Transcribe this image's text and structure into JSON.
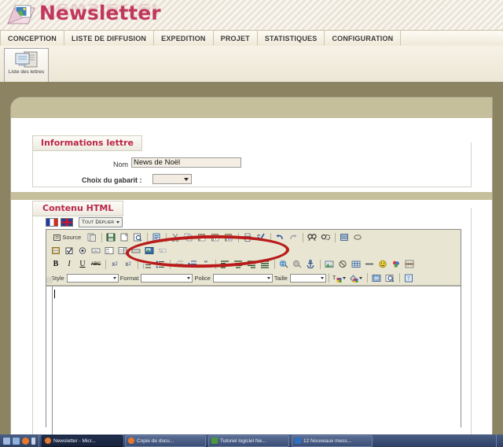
{
  "app": {
    "title": "Newsletter",
    "logo_icon": "envelope-letter-icon"
  },
  "main_menu": {
    "items": [
      {
        "label": "CONCEPTION",
        "name": "menu-conception"
      },
      {
        "label": "LISTE DE DIFFUSION",
        "name": "menu-liste-de-diffusion"
      },
      {
        "label": "EXPEDITION",
        "name": "menu-expedition"
      },
      {
        "label": "PROJET",
        "name": "menu-projet"
      },
      {
        "label": "STATISTIQUES",
        "name": "menu-statistiques"
      },
      {
        "label": "CONFIGURATION",
        "name": "menu-configuration"
      }
    ]
  },
  "toolbar": {
    "liste_des_lettres_label": "Liste des lettres",
    "liste_des_lettres_icon": "screen-document-icon"
  },
  "infos_lettre": {
    "legend": "Informations lettre",
    "nom_label": "Nom",
    "nom_value": "News de Noël",
    "gabarit_label": "Choix du gabarit :",
    "gabarit_value": ""
  },
  "annotation": {
    "shape": "red-ellipse-highlight",
    "color": "#b91b1b",
    "targets": "nom-input"
  },
  "contenu_html": {
    "legend": "Contenu HTML",
    "lang_flags": [
      {
        "name": "flag-fr-icon",
        "label": "Français"
      },
      {
        "name": "flag-uk-icon",
        "label": "English"
      }
    ],
    "tout_deplier_label": "Tout Déplier"
  },
  "editor": {
    "name": "html-wysiwyg-editor",
    "source_label": "Source",
    "rows": [
      {
        "name": "editor-toolbar-row-1",
        "items": [
          {
            "name": "source-button",
            "glyph": "☰",
            "label": "Source",
            "wide": true
          },
          {
            "name": "templates-icon",
            "glyph": "❐"
          },
          {
            "sep": true
          },
          {
            "name": "save-icon",
            "glyph": "▣"
          },
          {
            "name": "new-page-icon",
            "glyph": "☐"
          },
          {
            "name": "preview-icon",
            "glyph": "⌕"
          },
          {
            "sep": true
          },
          {
            "name": "document-properties-icon",
            "glyph": "☷"
          },
          {
            "sep": true
          },
          {
            "name": "cut-icon",
            "glyph": "✂"
          },
          {
            "name": "copy-icon",
            "glyph": "⧉"
          },
          {
            "name": "paste-icon",
            "glyph": "▤"
          },
          {
            "name": "paste-text-icon",
            "glyph": "▥"
          },
          {
            "name": "paste-word-icon",
            "glyph": "▦"
          },
          {
            "sep": true
          },
          {
            "name": "print-icon",
            "glyph": "⎙"
          },
          {
            "name": "spellcheck-icon",
            "glyph": "✓"
          },
          {
            "sep": true
          },
          {
            "name": "undo-icon",
            "glyph": "↶"
          },
          {
            "name": "redo-icon",
            "glyph": "↷"
          },
          {
            "sep": true
          },
          {
            "name": "find-icon",
            "glyph": "⚲"
          },
          {
            "name": "replace-icon",
            "glyph": "⟳"
          },
          {
            "sep": true
          },
          {
            "name": "select-all-icon",
            "glyph": "▦"
          },
          {
            "name": "remove-format-icon",
            "glyph": "⌀"
          }
        ]
      },
      {
        "name": "editor-toolbar-row-2",
        "items": [
          {
            "name": "form-icon",
            "glyph": "▤"
          },
          {
            "name": "checkbox-icon",
            "glyph": "☑"
          },
          {
            "name": "radio-button-icon",
            "glyph": "◉"
          },
          {
            "name": "text-field-icon",
            "glyph": "▭"
          },
          {
            "name": "textarea-icon",
            "glyph": "▧"
          },
          {
            "name": "select-field-icon",
            "glyph": "▤"
          },
          {
            "name": "button-icon",
            "glyph": "▬"
          },
          {
            "name": "image-button-icon",
            "glyph": "▨"
          },
          {
            "name": "hidden-field-icon",
            "glyph": "▫"
          }
        ]
      },
      {
        "name": "editor-toolbar-row-3",
        "items": [
          {
            "name": "bold-icon",
            "glyph": "B",
            "style": "bold"
          },
          {
            "name": "italic-icon",
            "glyph": "I",
            "style": "italic"
          },
          {
            "name": "underline-icon",
            "glyph": "U",
            "style": "underline"
          },
          {
            "name": "strikethrough-icon",
            "glyph": "ABC",
            "style": "strike"
          },
          {
            "sep": true
          },
          {
            "name": "subscript-icon",
            "glyph": "x₂"
          },
          {
            "name": "superscript-icon",
            "glyph": "x²"
          },
          {
            "sep": true
          },
          {
            "name": "numbered-list-icon",
            "glyph": "≣"
          },
          {
            "name": "bulleted-list-icon",
            "glyph": "≣"
          },
          {
            "sep": true
          },
          {
            "name": "outdent-icon",
            "glyph": "⇤"
          },
          {
            "name": "indent-icon",
            "glyph": "⇥"
          },
          {
            "name": "blockquote-icon",
            "glyph": "“"
          },
          {
            "sep": true
          },
          {
            "name": "align-left-icon",
            "glyph": "≡"
          },
          {
            "name": "align-center-icon",
            "glyph": "≡"
          },
          {
            "name": "align-right-icon",
            "glyph": "≡"
          },
          {
            "name": "align-justify-icon",
            "glyph": "≡"
          },
          {
            "sep": true
          },
          {
            "name": "link-icon",
            "glyph": "ἱ0"
          },
          {
            "name": "unlink-icon",
            "glyph": "⛭"
          },
          {
            "name": "anchor-icon",
            "glyph": "⚓"
          },
          {
            "sep": true
          },
          {
            "name": "image-icon",
            "glyph": "⛰"
          },
          {
            "name": "flash-icon",
            "glyph": "⊘"
          },
          {
            "name": "table-icon",
            "glyph": "▦"
          },
          {
            "name": "horizontal-rule-icon",
            "glyph": "—"
          },
          {
            "name": "smiley-icon",
            "glyph": "☺"
          },
          {
            "name": "special-char-icon",
            "glyph": "✤"
          },
          {
            "name": "page-break-icon",
            "glyph": "⏎"
          }
        ]
      }
    ],
    "combos": [
      {
        "name": "style-combo",
        "label": "Style",
        "value": "",
        "width": 66
      },
      {
        "name": "format-combo",
        "label": "Format",
        "value": "",
        "width": 66
      },
      {
        "name": "police-combo",
        "label": "Police",
        "value": "",
        "width": 76
      },
      {
        "name": "taille-combo",
        "label": "Taille",
        "value": "",
        "width": 46
      }
    ],
    "combo_extras": [
      {
        "name": "text-color-icon",
        "glyph": "T"
      },
      {
        "name": "background-color-icon",
        "glyph": "▰"
      },
      {
        "name": "show-blocks-icon",
        "glyph": "▣"
      },
      {
        "name": "maximize-icon",
        "glyph": "⌕"
      },
      {
        "name": "about-icon",
        "glyph": "?"
      }
    ],
    "body_content": ""
  },
  "taskbar": {
    "start_label": "",
    "quicklaunch": [
      {
        "name": "show-desktop-icon",
        "color": "#9fb8de"
      },
      {
        "name": "media-player-icon",
        "color": "#8fb0d8"
      },
      {
        "name": "browser-icon",
        "color": "#e8792a"
      },
      {
        "name": "more-icon",
        "color": "#c8d4e8"
      }
    ],
    "tasks": [
      {
        "name": "taskbar-item-1",
        "label": "Newsletter - Micr...",
        "icon_color": "#e8792a",
        "active": true
      },
      {
        "name": "taskbar-item-2",
        "label": "Copie de docu...",
        "icon_color": "#e8792a",
        "active": false
      },
      {
        "name": "taskbar-item-3",
        "label": "Tutoriel logiciel Ne...",
        "icon_color": "#4a9a3c",
        "active": false
      },
      {
        "name": "taskbar-item-4",
        "label": "12 Nouveaux mess...",
        "icon_color": "#2f6fc0",
        "active": false
      }
    ]
  }
}
